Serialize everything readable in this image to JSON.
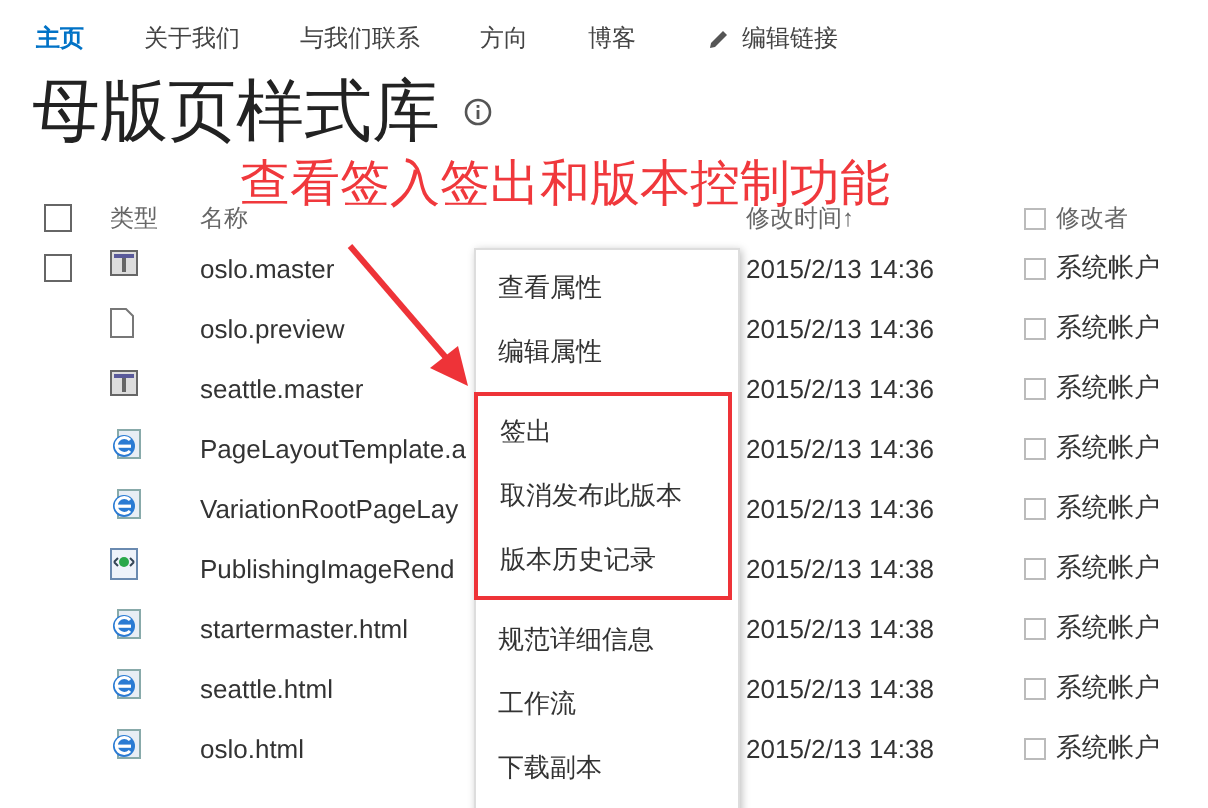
{
  "nav": {
    "items": [
      {
        "label": "主页",
        "selected": true
      },
      {
        "label": "关于我们",
        "selected": false
      },
      {
        "label": "与我们联系",
        "selected": false
      },
      {
        "label": "方向",
        "selected": false
      },
      {
        "label": "博客",
        "selected": false
      }
    ],
    "edit_link": "编辑链接"
  },
  "title": "母版页样式库",
  "table": {
    "columns": [
      "类型",
      "名称",
      "修改时间↑",
      "修改者"
    ],
    "select_all_checked": false,
    "modified_by_header_checked": false,
    "rows": [
      {
        "kind": "master",
        "name": "oslo.master",
        "modified": "2015/2/13 14:36",
        "modified_by": "系统帐户",
        "checked": false,
        "modified_by_checked": false
      },
      {
        "kind": "page",
        "name": "oslo.preview",
        "modified": "2015/2/13 14:36",
        "modified_by": "系统帐户",
        "modified_by_checked": false
      },
      {
        "kind": "master",
        "name": "seattle.master",
        "modified": "2015/2/13 14:36",
        "modified_by": "系统帐户",
        "modified_by_checked": false
      },
      {
        "kind": "html",
        "name": "PageLayoutTemplate.a",
        "modified": "2015/2/13 14:36",
        "modified_by": "系统帐户",
        "modified_by_checked": false
      },
      {
        "kind": "html",
        "name": "VariationRootPageLay",
        "modified": "2015/2/13 14:36",
        "modified_by": "系统帐户",
        "modified_by_checked": false
      },
      {
        "kind": "xml",
        "name": "PublishingImageRend",
        "modified": "2015/2/13 14:38",
        "modified_by": "系统帐户",
        "modified_by_checked": false
      },
      {
        "kind": "html",
        "name": "startermaster.html",
        "modified": "2015/2/13 14:38",
        "modified_by": "系统帐户",
        "modified_by_checked": false
      },
      {
        "kind": "html",
        "name": "seattle.html",
        "modified": "2015/2/13 14:38",
        "modified_by": "系统帐户",
        "modified_by_checked": false
      },
      {
        "kind": "html",
        "name": "oslo.html",
        "modified": "2015/2/13 14:38",
        "modified_by": "系统帐户",
        "modified_by_checked": false
      }
    ]
  },
  "context_menu": {
    "items": [
      {
        "label": "查看属性",
        "highlighted": false
      },
      {
        "label": "编辑属性",
        "highlighted": false
      },
      {
        "label": "签出",
        "highlighted": true
      },
      {
        "label": "取消发布此版本",
        "highlighted": true
      },
      {
        "label": "版本历史记录",
        "highlighted": true
      },
      {
        "label": "规范详细信息",
        "highlighted": false
      },
      {
        "label": "工作流",
        "highlighted": false
      },
      {
        "label": "下载副本",
        "highlighted": false
      }
    ]
  },
  "annotation": "查看签入签出和版本控制功能"
}
